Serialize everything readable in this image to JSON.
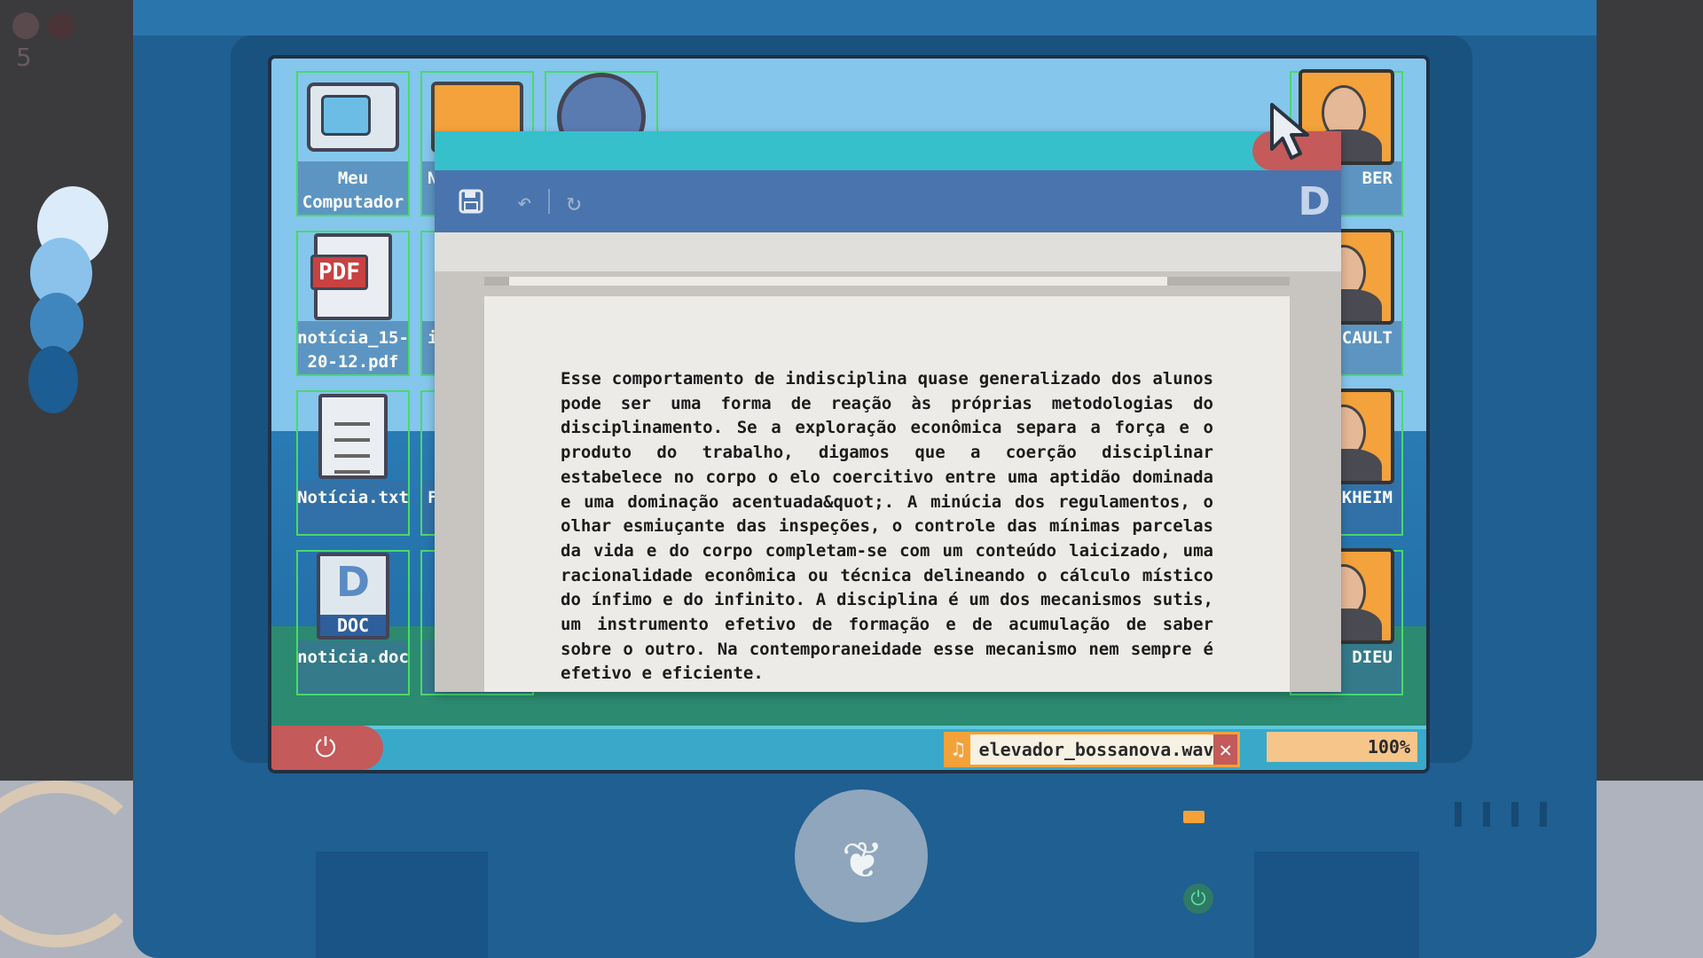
{
  "hud": {
    "counter": "5"
  },
  "desktop": {
    "icons_left": [
      {
        "name": "my-computer",
        "label": "Meu Computador",
        "icon": "computer-icon"
      },
      {
        "name": "pdf",
        "label": "notícia_15-20-12.pdf",
        "icon": "pdf-icon"
      },
      {
        "name": "txt",
        "label": "Notícia.txt",
        "icon": "text-file-icon"
      },
      {
        "name": "doc",
        "label": "noticia.doc",
        "icon": "doc-file-icon"
      }
    ],
    "icons_middle": [
      {
        "name": "folder",
        "label": "N",
        "icon": "folder-icon"
      },
      {
        "name": "internet",
        "label": "",
        "icon": "globe-icon"
      },
      {
        "name": "in",
        "label": "in",
        "icon": "file-icon"
      },
      {
        "name": "f",
        "label": "F",
        "icon": "file-icon"
      }
    ],
    "icons_right": [
      {
        "name": "weber",
        "label": "BER",
        "icon": "portrait-icon"
      },
      {
        "name": "foucault",
        "label": "CAULT",
        "icon": "portrait-icon"
      },
      {
        "name": "durkheim",
        "label": "KHEIM",
        "icon": "portrait-icon"
      },
      {
        "name": "bourdieu",
        "label": "DIEU",
        "icon": "portrait-icon"
      }
    ]
  },
  "window": {
    "toolbar": {
      "save_icon": "save-icon",
      "undo_icon": "undo-icon",
      "redo_icon": "redo-icon",
      "logo": "D"
    },
    "document_text": "Esse comportamento de indisciplina quase generalizado dos alunos pode ser uma forma de reação às próprias metodologias do disciplinamento. Se a exploração econômica separa a força e o produto do trabalho, digamos que a coerção disciplinar estabelece no corpo o elo coercitivo entre uma aptidão dominada e uma dominação acentuada&quot;. A minúcia dos regulamentos, o olhar esmiuçante das inspeções, o controle das mínimas parcelas da vida e do corpo completam-se com um conteúdo laicizado, uma racionalidade econômica ou técnica delineando o cálculo místico do ínfimo e do infinito. A disciplina é um dos mecanismos sutis, um instrumento efetivo de formação e de acumulação de saber sobre o outro. Na contemporaneidade esse mecanismo nem sempre é efetivo e eficiente."
  },
  "taskbar": {
    "media_file": "elevador_bossanova.wav",
    "volume": "100%"
  },
  "colors": {
    "taskbar": "#3aa8c9",
    "window_toolbar": "#4a74ad",
    "accent_orange": "#f3a23a",
    "close_red": "#c45a5a"
  }
}
